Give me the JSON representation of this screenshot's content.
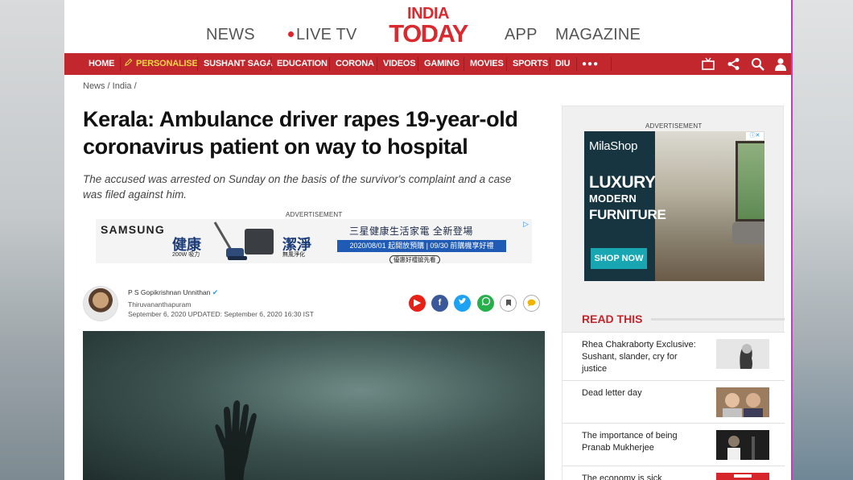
{
  "topnav": {
    "news": "NEWS",
    "live_tv": "LIVE TV",
    "logo_line1": "INDIA",
    "logo_line2": "TODAY",
    "app": "APP",
    "magazine": "MAGAZINE"
  },
  "menu": {
    "items": [
      "HOME",
      "PERSONALISE",
      "SUSHANT SAGA",
      "EDUCATION",
      "CORONA",
      "VIDEOS",
      "GAMING",
      "MOVIES",
      "SPORTS",
      "DIU",
      "●●●"
    ],
    "icons": [
      "tv-icon",
      "share-icon",
      "search-icon",
      "user-icon"
    ]
  },
  "breadcrumb": "News / India /",
  "article": {
    "headline": "Kerala: Ambulance driver rapes 19-year-old coronavirus patient on way to hospital",
    "summary": "The accused was arrested on Sunday on the basis of the survivor's complaint and a case was filed against him.",
    "ad_label": "ADVERTISEMENT",
    "author": "P S Gopikrishnan Unnithan",
    "location": "Thiruvananthapuram",
    "date": "September 6, 2020 UPDATED: September 6, 2020 16:30 IST"
  },
  "ad1": {
    "brand": "SAMSUNG",
    "text1": "健康",
    "text1_sub": "200W 吸力",
    "text2": "潔淨",
    "text2_sub": "無風淨化",
    "headline": "三星健康生活家電 全新登場",
    "dates": "2020/08/01 起開放預購 | 09/30 前購機享好禮",
    "cta": "優惠好禮搶先看"
  },
  "sidebar": {
    "ad_label": "ADVERTISEMENT",
    "ad": {
      "brand": "MilaShop",
      "luxury": "LUXURY",
      "modern": "MODERN",
      "furniture": "FURNITURE",
      "cta": "SHOP NOW"
    },
    "read_this": "READ THIS",
    "items": [
      {
        "title": "Rhea Chakraborty Exclusive: Sushant, slander, cry for justice"
      },
      {
        "title": "Dead letter day"
      },
      {
        "title": "The importance of being Pranab Mukherjee"
      },
      {
        "title": "The economy is sick"
      }
    ]
  },
  "colors": {
    "brand_red": "#c1272d",
    "personalise_yellow": "#f5d547"
  }
}
